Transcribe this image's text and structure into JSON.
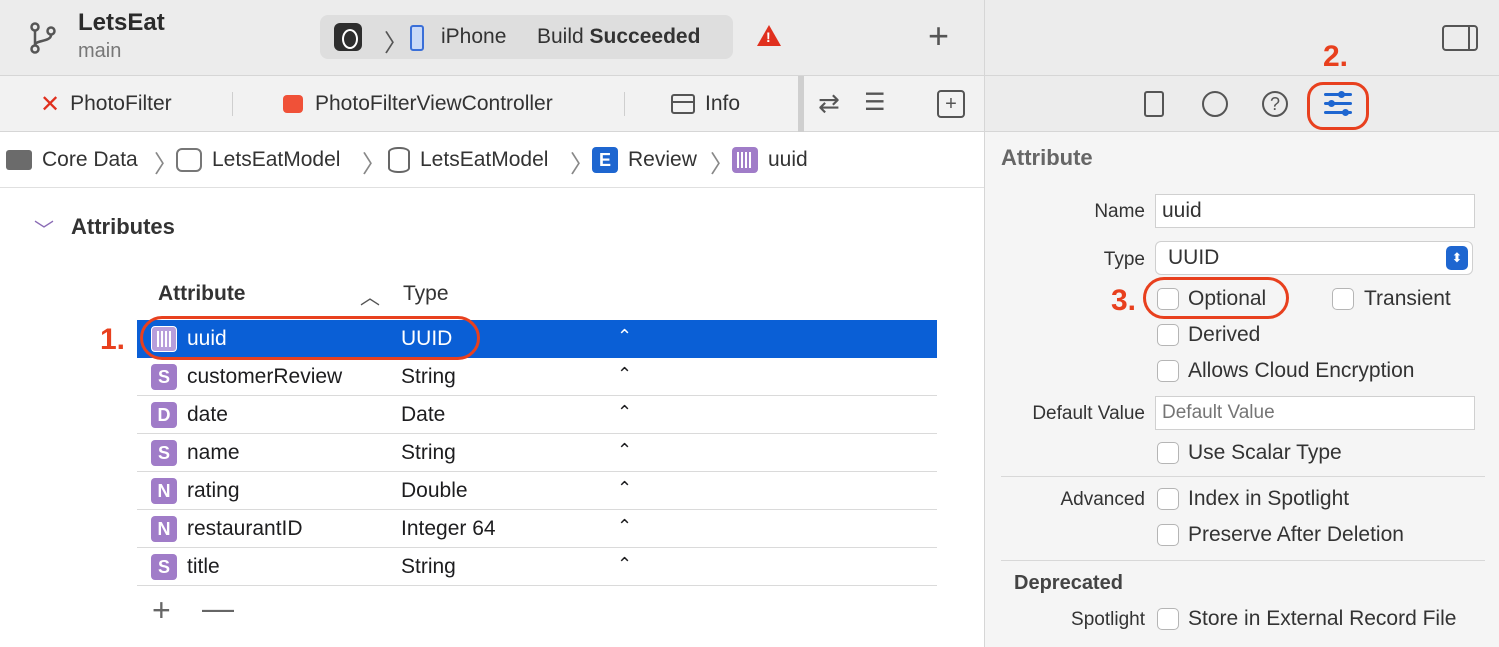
{
  "toolbar": {
    "project_name": "LetsEat",
    "branch": "main",
    "device": "iPhone",
    "build_prefix": "Build",
    "build_status": "Succeeded",
    "icons": [
      "branch-icon",
      "app-scheme-icon",
      "device-icon",
      "warning-icon",
      "add-icon"
    ]
  },
  "tabs": [
    {
      "label": "PhotoFilter",
      "icon": "x-icon"
    },
    {
      "label": "PhotoFilterViewController",
      "icon": "swift-icon"
    },
    {
      "label": "Info",
      "icon": "table-icon"
    }
  ],
  "jumpbar": [
    "Core Data",
    "LetsEatModel",
    "LetsEatModel",
    "Review",
    "uuid"
  ],
  "section": {
    "title": "Attributes"
  },
  "table": {
    "columns": {
      "attribute": "Attribute",
      "type": "Type"
    },
    "rows": [
      {
        "badge": "",
        "name": "uuid",
        "type": "UUID",
        "selected": true
      },
      {
        "badge": "S",
        "name": "customerReview",
        "type": "String"
      },
      {
        "badge": "D",
        "name": "date",
        "type": "Date"
      },
      {
        "badge": "S",
        "name": "name",
        "type": "String"
      },
      {
        "badge": "N",
        "name": "rating",
        "type": "Double"
      },
      {
        "badge": "N",
        "name": "restaurantID",
        "type": "Integer 64"
      },
      {
        "badge": "S",
        "name": "title",
        "type": "String"
      }
    ],
    "add_label": "+",
    "remove_label": "—"
  },
  "annotations": {
    "step1": "1.",
    "step2": "2.",
    "step3": "3."
  },
  "inspector": {
    "title": "Attribute",
    "name_label": "Name",
    "name_value": "uuid",
    "type_label": "Type",
    "type_value": "UUID",
    "checkboxes": {
      "optional": "Optional",
      "transient": "Transient",
      "derived": "Derived",
      "cloud": "Allows Cloud Encryption",
      "scalar": "Use Scalar Type",
      "spotlight": "Index in Spotlight",
      "preserve": "Preserve After Deletion",
      "external": "Store in External Record File"
    },
    "default_label": "Default Value",
    "default_placeholder": "Default Value",
    "advanced_label": "Advanced",
    "deprecated_title": "Deprecated",
    "spotlight_label": "Spotlight"
  },
  "colors": {
    "accent": "#0a5fd6",
    "annotation": "#e8401e",
    "badge": "#a07cc8"
  }
}
